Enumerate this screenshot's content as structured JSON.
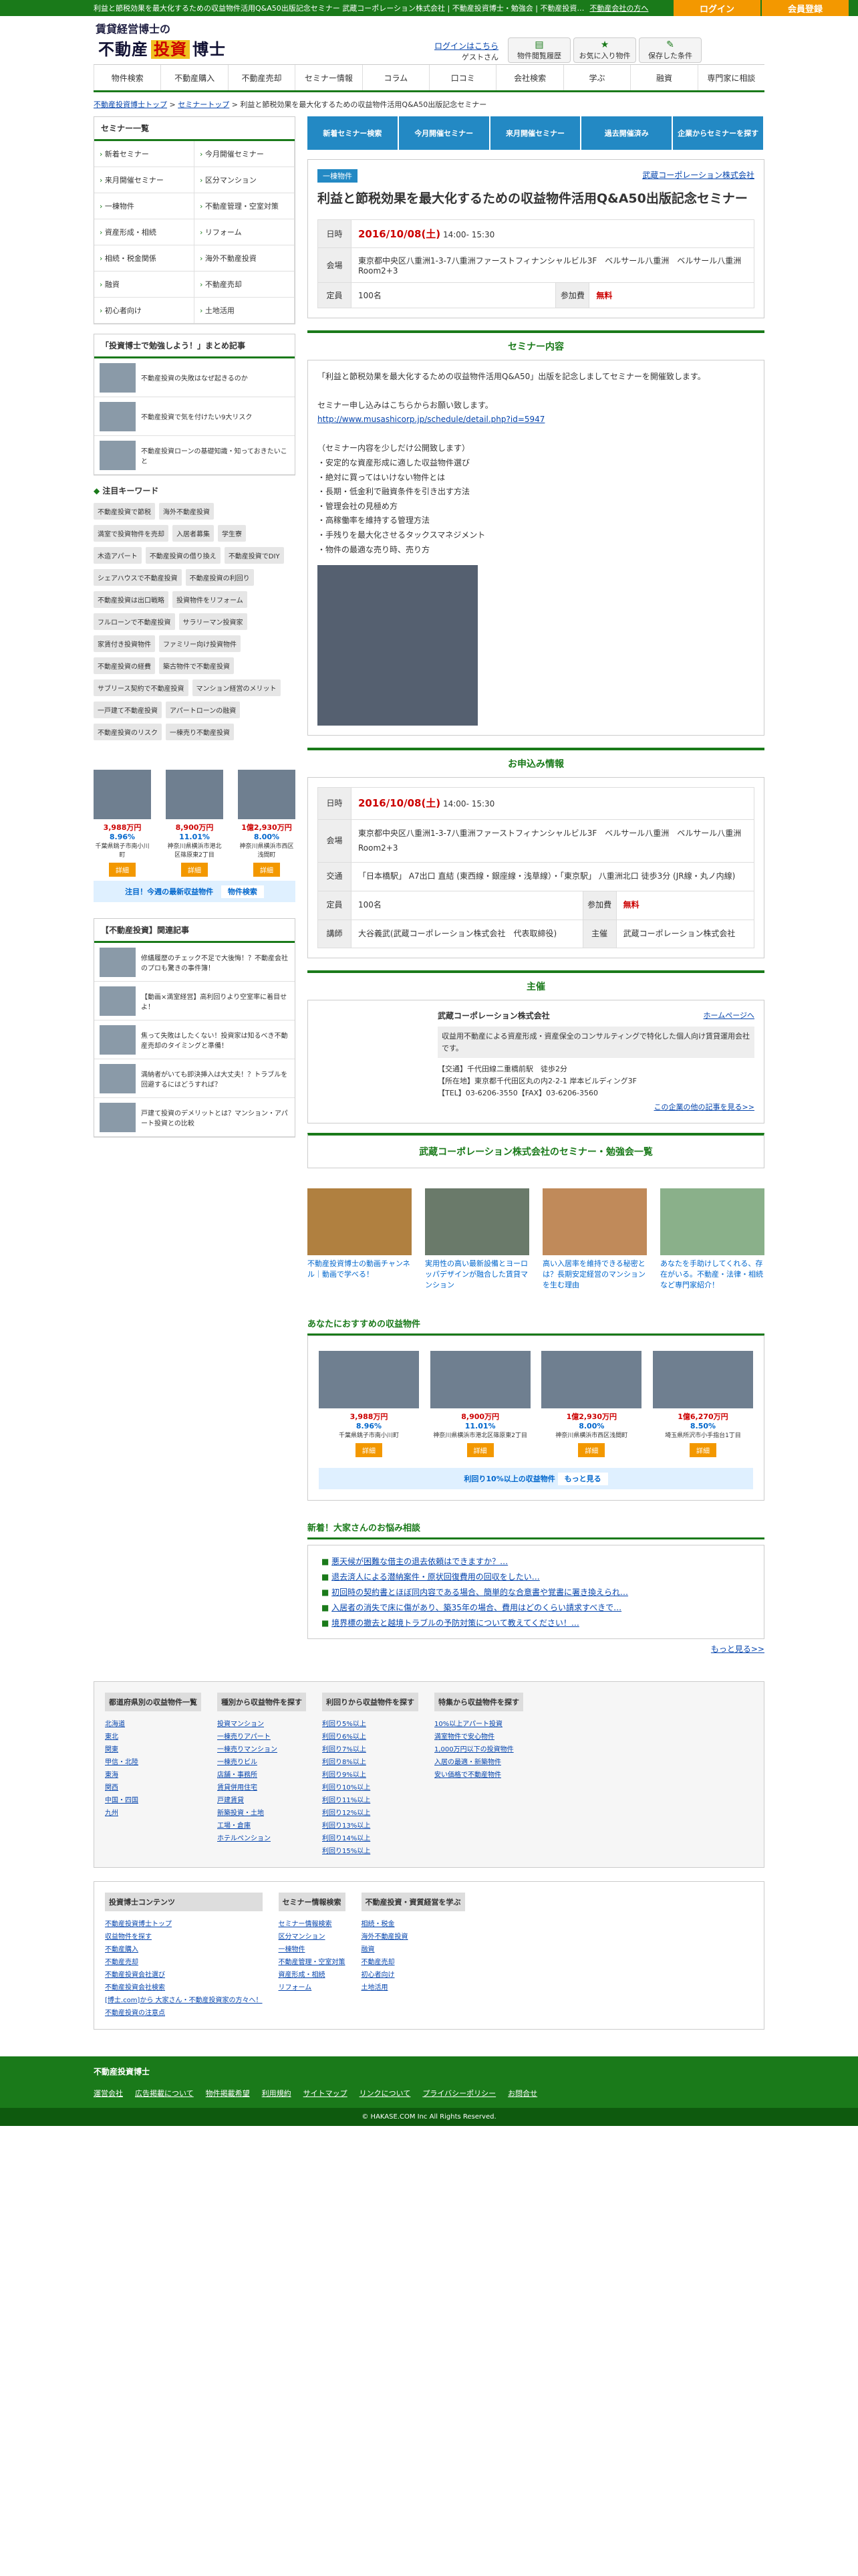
{
  "topbar": {
    "text": "利益と節税効果を最大化するための収益物件活用Q&A50出版記念セミナー 武蔵コーポレーション株式会社 | 不動産投資博士・勉強会 | 不動産投資…",
    "link": "不動産会社の方へ",
    "login": "ログイン",
    "register": "会員登録"
  },
  "header": {
    "logo1": "賃貸経営博士の",
    "logo2a": "不動産",
    "logo2b": "投資",
    "logo2c": "博士",
    "user_link": "ログインはこちら",
    "user_name": "ゲストさん",
    "icons": [
      {
        "ic": "▤",
        "label": "物件閲覧履歴"
      },
      {
        "ic": "★",
        "label": "お気に入り物件"
      },
      {
        "ic": "✎",
        "label": "保存した条件"
      }
    ]
  },
  "gnav": [
    "物件検索",
    "不動産購入",
    "不動産売却",
    "セミナー情報",
    "コラム",
    "口コミ",
    "会社検索",
    "学ぶ",
    "融資",
    "専門家に相談"
  ],
  "breadcrumb": [
    "不動産投資博士トップ",
    "セミナートップ",
    "利益と節税効果を最大化するための収益物件活用Q&A50出版記念セミナー"
  ],
  "side": {
    "cat_title": "セミナー一覧",
    "cats": [
      "新着セミナー",
      "今月開催セミナー",
      "来月開催セミナー",
      "区分マンション",
      "一棟物件",
      "不動産管理・空室対策",
      "資産形成・相続",
      "リフォーム",
      "相続・税金関係",
      "海外不動産投資",
      "融資",
      "不動産売却",
      "初心者向け",
      "土地活用"
    ],
    "art_title": "「投資博士で勉強しよう！」まとめ記事",
    "arts": [
      "不動産投資の失敗はなぜ起きるのか",
      "不動産投資で気を付けたい9大リスク",
      "不動産投資ローンの基礎知識・知っておきたいこと"
    ],
    "kw_title": "注目キーワード",
    "kws": [
      "不動産投資で節税",
      "海外不動産投資",
      "満室で投資物件を売却",
      "入居者募集",
      "学生寮",
      "木造アパート",
      "不動産投資の借り換え",
      "不動産投資でDIY",
      "シェアハウスで不動産投資",
      "不動産投資の利回り",
      "不動産投資は出口戦略",
      "投資物件をリフォーム",
      "フルローンで不動産投資",
      "サラリーマン投資家",
      "家賃付き投資物件",
      "ファミリー向け投資物件",
      "不動産投資の経費",
      "築古物件で不動産投資",
      "サブリース契約で不動産投資",
      "マンション経営のメリット",
      "一戸建て不動産投資",
      "アパートローンの融資",
      "不動産投資のリスク",
      "一棟売り不動産投資"
    ],
    "props": [
      {
        "price": "3,988万円",
        "rate": "8.96%",
        "loc": "千葉県銚子市南小川町"
      },
      {
        "price": "8,900万円",
        "rate": "11.01%",
        "loc": "神奈川県横浜市港北区篠原東2丁目"
      },
      {
        "price": "1億2,930万円",
        "rate": "8.00%",
        "loc": "神奈川県横浜市西区浅間町"
      }
    ],
    "detail": "詳細",
    "notice": "注目！今週の最新収益物件",
    "notice_btn": "物件検索",
    "rel_title": "【不動産投資】関連記事",
    "rels": [
      "修繕履歴のチェック不足で大後悔！？不動産会社のプロも驚きの事件簿！",
      "【動画×満室経営】高利回りより空室率に着目せよ！",
      "焦って失敗はしたくない！投資家は知るべき不動産売却のタイミングと準備！",
      "満納者がいても即決挿入は大丈夫！？トラブルを回避するにはどうすれば？",
      "戸建て投資のデメリットとは？マンション・アパート投資との比較"
    ]
  },
  "main": {
    "tabs": [
      "新着セミナー検索",
      "今月開催セミナー",
      "来月開催セミナー",
      "過去開催済み",
      "企業からセミナーを探す"
    ],
    "badge": "一棟物件",
    "org": "武蔵コーポレーション株式会社",
    "title": "利益と節税効果を最大化するための収益物件活用Q&A50出版記念セミナー",
    "info": {
      "date_h": "日時",
      "date": "2016/10/08(土)",
      "time": " 14:00- 15:30",
      "venue_h": "会場",
      "venue": "東京都中央区八重洲1-3-7八重洲ファーストフィナンシャルビル3F　ベルサール八重洲　ベルサール八重洲　Room2+3",
      "cap_h": "定員",
      "cap": "100名",
      "fee_h": "参加費",
      "fee": "無料"
    },
    "content_h": "セミナー内容",
    "content": [
      "「利益と節税効果を最大化するための収益物件活用Q&A50」出版を記念しましてセミナーを開催致します。",
      "セミナー申し込みはこちらからお願い致します。"
    ],
    "url": "http://www.musashicorp.jp/schedule/detail.php?id=5947",
    "bullets": [
      "（セミナー内容を少しだけ公開致します）",
      "・安定的な資産形成に適した収益物件選び",
      "・絶対に買ってはいけない物件とは",
      "・長期・低金利で融資条件を引き出す方法",
      "・管理会社の見極め方",
      "・高稼働率を維持する管理方法",
      "・手残りを最大化させるタックスマネジメント",
      "・物件の最適な売り時、売り方"
    ],
    "apply_h": "お申込み情報",
    "access_h": "交通",
    "access": "「日本橋駅」 A7出口 直結 (東西線・銀座線・浅草線）・「東京駅」 八重洲北口 徒歩3分 (JR線・丸ノ内線)",
    "lecturer_h": "講師",
    "lecturer": "大谷義武(武蔵コーポレーション株式会社　代表取締役)",
    "host_h": "主催",
    "host": "武蔵コーポレーション株式会社",
    "shusai_h": "主催",
    "shusai_name": "武蔵コーポレーション株式会社",
    "shusai_link": "ホームページへ",
    "shusai_desc": "収益用不動産による資産形成・資産保全のコンサルティングで特化した個人向け賃貸運用会社です。",
    "shusai_addr": [
      "【交通】千代田線二重橋前駅　徒歩2分",
      "【所在地】東京都千代田区丸の内2-2-1 岸本ビルディング3F",
      "【TEL】03-6206-3550【FAX】03-6206-3560"
    ],
    "shusai_more": "この企業の他の記事を見る>>",
    "list_h": "武蔵コーポレーション株式会社のセミナー・勉強会一覧",
    "promos": [
      "不動産投資博士の動画チャンネル｜動画で学べる！",
      "実用性の高い最新設備とヨーロッパデザインが融合した賃貸マンション",
      "高い入居率を維持できる秘密とは？長期安定経営のマンションを生む理由",
      "あなたを手助けしてくれる、存在がいる。不動産・法律・相続など専門家紹介！"
    ],
    "rec_h": "あなたにおすすめの収益物件",
    "rec_props": [
      {
        "price": "3,988万円",
        "rate": "8.96%",
        "loc": "千葉県銚子市南小川町"
      },
      {
        "price": "8,900万円",
        "rate": "11.01%",
        "loc": "神奈川県横浜市港北区篠原東2丁目"
      },
      {
        "price": "1億2,930万円",
        "rate": "8.00%",
        "loc": "神奈川県横浜市西区浅間町"
      },
      {
        "price": "1億6,270万円",
        "rate": "8.50%",
        "loc": "埼玉県所沢市小手指台1丁目"
      }
    ],
    "rec_notice": "利回り10%以上の収益物件",
    "rec_more": "もっと見る",
    "news_h": "新着！大家さんのお悩み相談",
    "news": [
      "悪天候が困難な借主の退去依頼はできますか？…",
      "退去済人による潜納案件・原状回復費用の回収をしたい…",
      "初回時の契約書とほぼ同内容である場合、簡単的な合意書や覚書に署き換えられ…",
      "入居者の消失で床に傷があり、築35年の場合、費用はどのくらい請求すべきで…",
      "境界標の撤去と越境トラブルの予防対策について教えてください！…"
    ],
    "news_more": "もっと見る>>"
  },
  "footer": {
    "cols": [
      {
        "h": "都道府県別の収益物件一覧",
        "items": [
          "北海道",
          "東北",
          "関東",
          "甲信・北陸",
          "東海",
          "関西",
          "中国・四国",
          "九州"
        ]
      },
      {
        "h": "種別から収益物件を探す",
        "items": [
          "投資マンション",
          "一棟売りアパート",
          "一棟売りマンション",
          "一棟売りビル",
          "店舗・事務所",
          "賃貸併用住宅",
          "戸建賃貸",
          "新築投資・土地",
          "工場・倉庫",
          "ホテルペンション"
        ]
      },
      {
        "h": "利回りから収益物件を探す",
        "items": [
          "利回り5%以上",
          "利回り6%以上",
          "利回り7%以上",
          "利回り8%以上",
          "利回り9%以上",
          "利回り10%以上",
          "利回り11%以上",
          "利回り12%以上",
          "利回り13%以上",
          "利回り14%以上",
          "利回り15%以上"
        ]
      },
      {
        "h": "特集から収益物件を探す",
        "items": [
          "10%以上アパート投資",
          "満室物件で安心物件",
          "1,000万円以下の投資物件",
          "入居の最適・新築物件",
          "安い価格で不動産物件"
        ]
      }
    ],
    "cols2": [
      {
        "h": "投資博士コンテンツ",
        "items": [
          "不動産投資博士トップ",
          "収益物件を探す",
          "不動産購入",
          "不動産売却",
          "不動産投資会社選び",
          "不動産投資会社検索",
          "[博士.com]から 大家さん・不動産投資家の方々へ！",
          "不動産投資の注意点"
        ]
      },
      {
        "h": "セミナー情報検索",
        "items": [
          "セミナー情報検索",
          "区分マンション",
          "一棟物件",
          "不動産管理・空室対策",
          "資産形成・相続",
          "リフォーム"
        ]
      },
      {
        "h": "不動産投資・資質経営を学ぶ",
        "items": [
          "相続・税金",
          "海外不動産投資",
          "融資",
          "不動産売却",
          "初心者向け",
          "土地活用"
        ]
      }
    ],
    "bottom_title": "不動産投資博士",
    "links": [
      "運営会社",
      "広告掲載について",
      "物件掲載希望",
      "利用規約",
      "サイトマップ",
      "リンクについて",
      "プライバシーポリシー",
      "お問合せ"
    ],
    "copy": "© HAKASE.COM Inc All Rights Reserved."
  }
}
